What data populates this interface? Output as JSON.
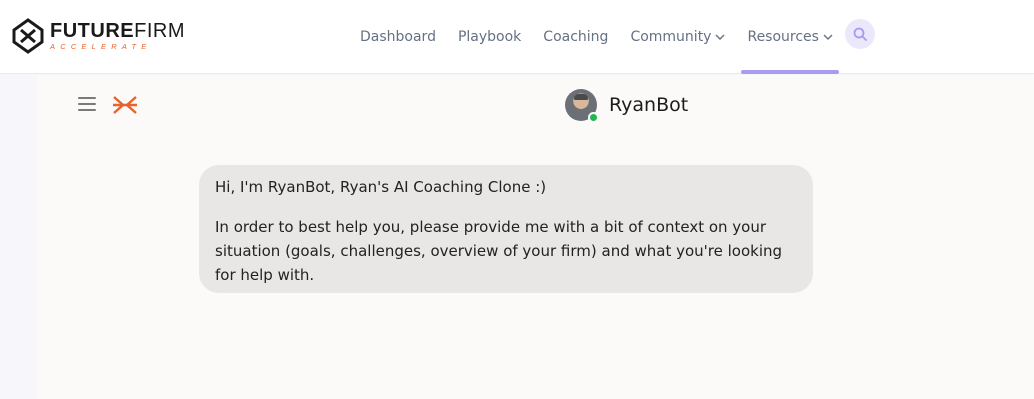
{
  "brand": {
    "name_bold": "FUTURE",
    "name_light": "FIRM",
    "tagline": "ACCELERATE",
    "accent_color": "#e8622a"
  },
  "nav": {
    "items": [
      {
        "label": "Dashboard",
        "dropdown": false
      },
      {
        "label": "Playbook",
        "dropdown": false
      },
      {
        "label": "Coaching",
        "dropdown": false
      },
      {
        "label": "Community",
        "dropdown": true
      },
      {
        "label": "Resources",
        "dropdown": true,
        "active": true
      }
    ],
    "active_color": "#a99bf0",
    "search_icon": "search-icon"
  },
  "chat": {
    "bot_name": "RyanBot",
    "status": "online",
    "status_color": "#22b455",
    "messages": [
      {
        "from": "bot",
        "paragraphs": [
          "Hi, I'm RyanBot, Ryan's AI Coaching Clone :)",
          "In order to best help you, please provide me with a bit of context on your situation (goals, challenges, overview of your firm) and what you're looking for help with."
        ]
      }
    ]
  },
  "icons": {
    "menu": "hamburger-menu-icon",
    "brand_mark": "futurefirm-mark-icon",
    "chevron": "chevron-down-icon"
  }
}
